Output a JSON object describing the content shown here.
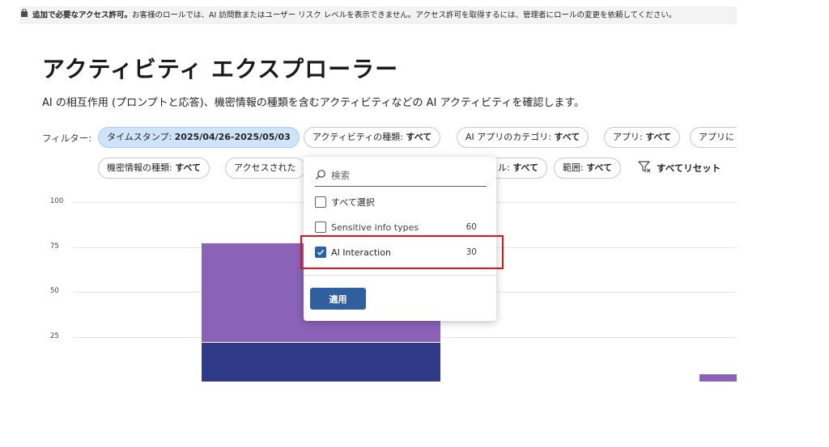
{
  "banner": {
    "icon": "lock-icon",
    "bold": "追加で必要なアクセス許可。",
    "text": "お客様のロールでは、AI 訪問数またはユーザー リスク レベルを表示できません。アクセス許可を取得するには、管理者にロールの変更を依頼してください。"
  },
  "page": {
    "title": "アクティビティ エクスプローラー",
    "subtitle": "AI の相互作用 (プロンプトと応答)、機密情報の種類を含むアクティビティなどの AI アクティビティを確認します。"
  },
  "filters": {
    "label": "フィルター:",
    "row1": [
      {
        "name": "タイムスタンプ: ",
        "value": "2025/04/26-2025/05/03"
      },
      {
        "name": "アクティビティの種類: ",
        "value": "すべて"
      },
      {
        "name": "AI アプリのカテゴリ: ",
        "value": "すべて"
      },
      {
        "name": "アプリ: ",
        "value": "すべて"
      },
      {
        "name": "アプリに",
        "value": ""
      }
    ],
    "row2": [
      {
        "name": "機密情報の種類: ",
        "value": "すべて"
      },
      {
        "name": "アクセスされた",
        "value": ""
      },
      {
        "name": "ル: ",
        "value": "すべて"
      },
      {
        "name": "範囲: ",
        "value": "すべて"
      }
    ],
    "reset_label": "すべてリセット",
    "accent_active": "#cfe4fa"
  },
  "dropdown": {
    "search_placeholder": "検索",
    "select_all": "すべて選択",
    "options": [
      {
        "label": "Sensitive info types",
        "count": "60",
        "checked": false
      },
      {
        "label": "AI Interaction",
        "count": "30",
        "checked": true
      }
    ],
    "apply_label": "適用",
    "apply_color": "#2f5f9e"
  },
  "chart_data": {
    "type": "bar",
    "stacked": true,
    "y_ticks": [
      "100",
      "75",
      "50",
      "25"
    ],
    "ylim": [
      0,
      100
    ],
    "grid": true,
    "series": [
      {
        "color": "#2e3a87",
        "values": [
          22,
          0
        ]
      },
      {
        "color": "#8a63b8",
        "values": [
          55,
          4
        ]
      }
    ]
  }
}
